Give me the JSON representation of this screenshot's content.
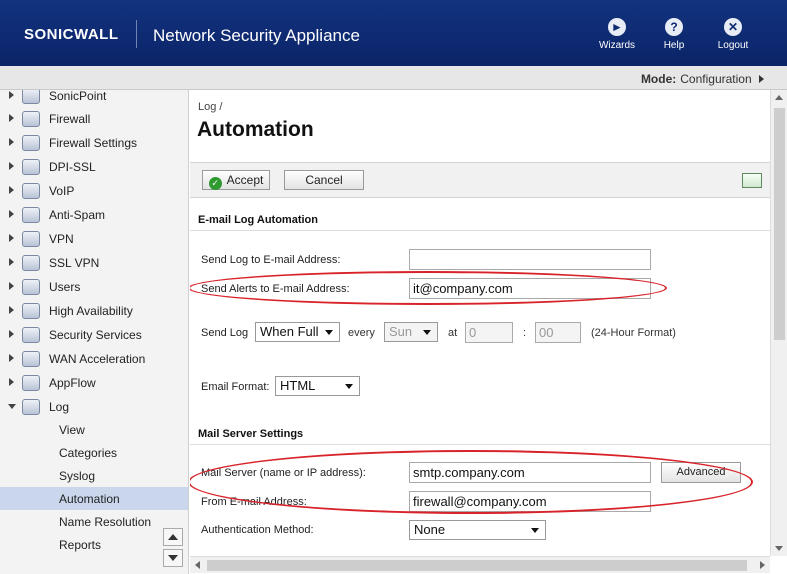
{
  "header": {
    "brand": "SONICWALL",
    "title": "Network Security Appliance",
    "buttons": [
      {
        "label": "Wizards",
        "icon": "wizard-icon"
      },
      {
        "label": "Help",
        "icon": "help-icon"
      },
      {
        "label": "Logout",
        "icon": "logout-icon"
      }
    ]
  },
  "mode": {
    "label": "Mode:",
    "value": "Configuration"
  },
  "sidebar": {
    "items": [
      {
        "label": "SonicPoint",
        "icon": "sonicpoint-icon"
      },
      {
        "label": "Firewall",
        "icon": "firewall-icon"
      },
      {
        "label": "Firewall Settings",
        "icon": "gear-icon"
      },
      {
        "label": "DPI-SSL",
        "icon": "dpi-ssl-icon"
      },
      {
        "label": "VoIP",
        "icon": "headset-icon"
      },
      {
        "label": "Anti-Spam",
        "icon": "mail-icon"
      },
      {
        "label": "VPN",
        "icon": "lock-icon"
      },
      {
        "label": "SSL VPN",
        "icon": "ssl-vpn-icon"
      },
      {
        "label": "Users",
        "icon": "users-icon"
      },
      {
        "label": "High Availability",
        "icon": "high-availability-icon"
      },
      {
        "label": "Security Services",
        "icon": "shield-icon"
      },
      {
        "label": "WAN Acceleration",
        "icon": "wan-icon"
      },
      {
        "label": "AppFlow",
        "icon": "chart-icon"
      },
      {
        "label": "Log",
        "icon": "log-icon"
      }
    ],
    "log_subitems": [
      "View",
      "Categories",
      "Syslog",
      "Automation",
      "Name Resolution",
      "Reports"
    ],
    "active_subitem": "Automation"
  },
  "main": {
    "breadcrumb": "Log /",
    "title": "Automation",
    "accept_label": "Accept",
    "cancel_label": "Cancel",
    "email_section": {
      "heading": "E-mail Log Automation",
      "send_log_label": "Send Log to E-mail Address:",
      "send_log_value": "",
      "send_alerts_label": "Send Alerts to E-mail Address:",
      "send_alerts_value": "it@company.com",
      "send_log_when_label": "Send Log",
      "send_log_when_value": "When Full",
      "every_label": "every",
      "day_value": "Sun",
      "at_label": "at",
      "hour_value": "0",
      "colon": ":",
      "minute_value": "00",
      "format_hint": "(24-Hour Format)",
      "email_format_label": "Email Format:",
      "email_format_value": "HTML"
    },
    "mail_section": {
      "heading": "Mail Server Settings",
      "server_label": "Mail Server (name or IP address):",
      "server_value": "smtp.company.com",
      "advanced_label": "Advanced",
      "from_label": "From E-mail Address:",
      "from_value": "firewall@company.com",
      "auth_label": "Authentication Method:",
      "auth_value": "None"
    }
  },
  "colors": {
    "header_bg": "#0e2a70",
    "highlight_oval": "#d8232a",
    "active_item": "#c9d6ec"
  }
}
